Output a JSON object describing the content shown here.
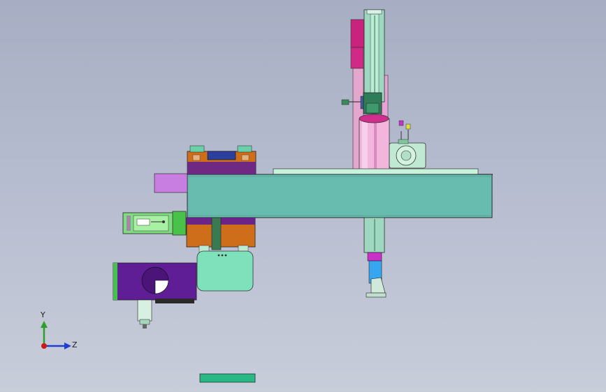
{
  "view": {
    "background_top": "#a7aec3",
    "background_bottom": "#c8cdda"
  },
  "triad": {
    "y_label": "Y",
    "z_label": "Z",
    "y_color": "#2aa02a",
    "z_color": "#1f3fd0",
    "x_color": "#d01818"
  },
  "colors": {
    "beam": "#67bcaf",
    "rail": "#9ed8c0",
    "orange": "#cf6e1a",
    "purple": "#5f1d96",
    "pink": "#e4aed0",
    "magenta": "#c8237d",
    "violet": "#c87ee0",
    "mint": "#7fe0bc",
    "green": "#5fd060",
    "blue": "#36a6f0",
    "teal_bar": "#28b886"
  }
}
